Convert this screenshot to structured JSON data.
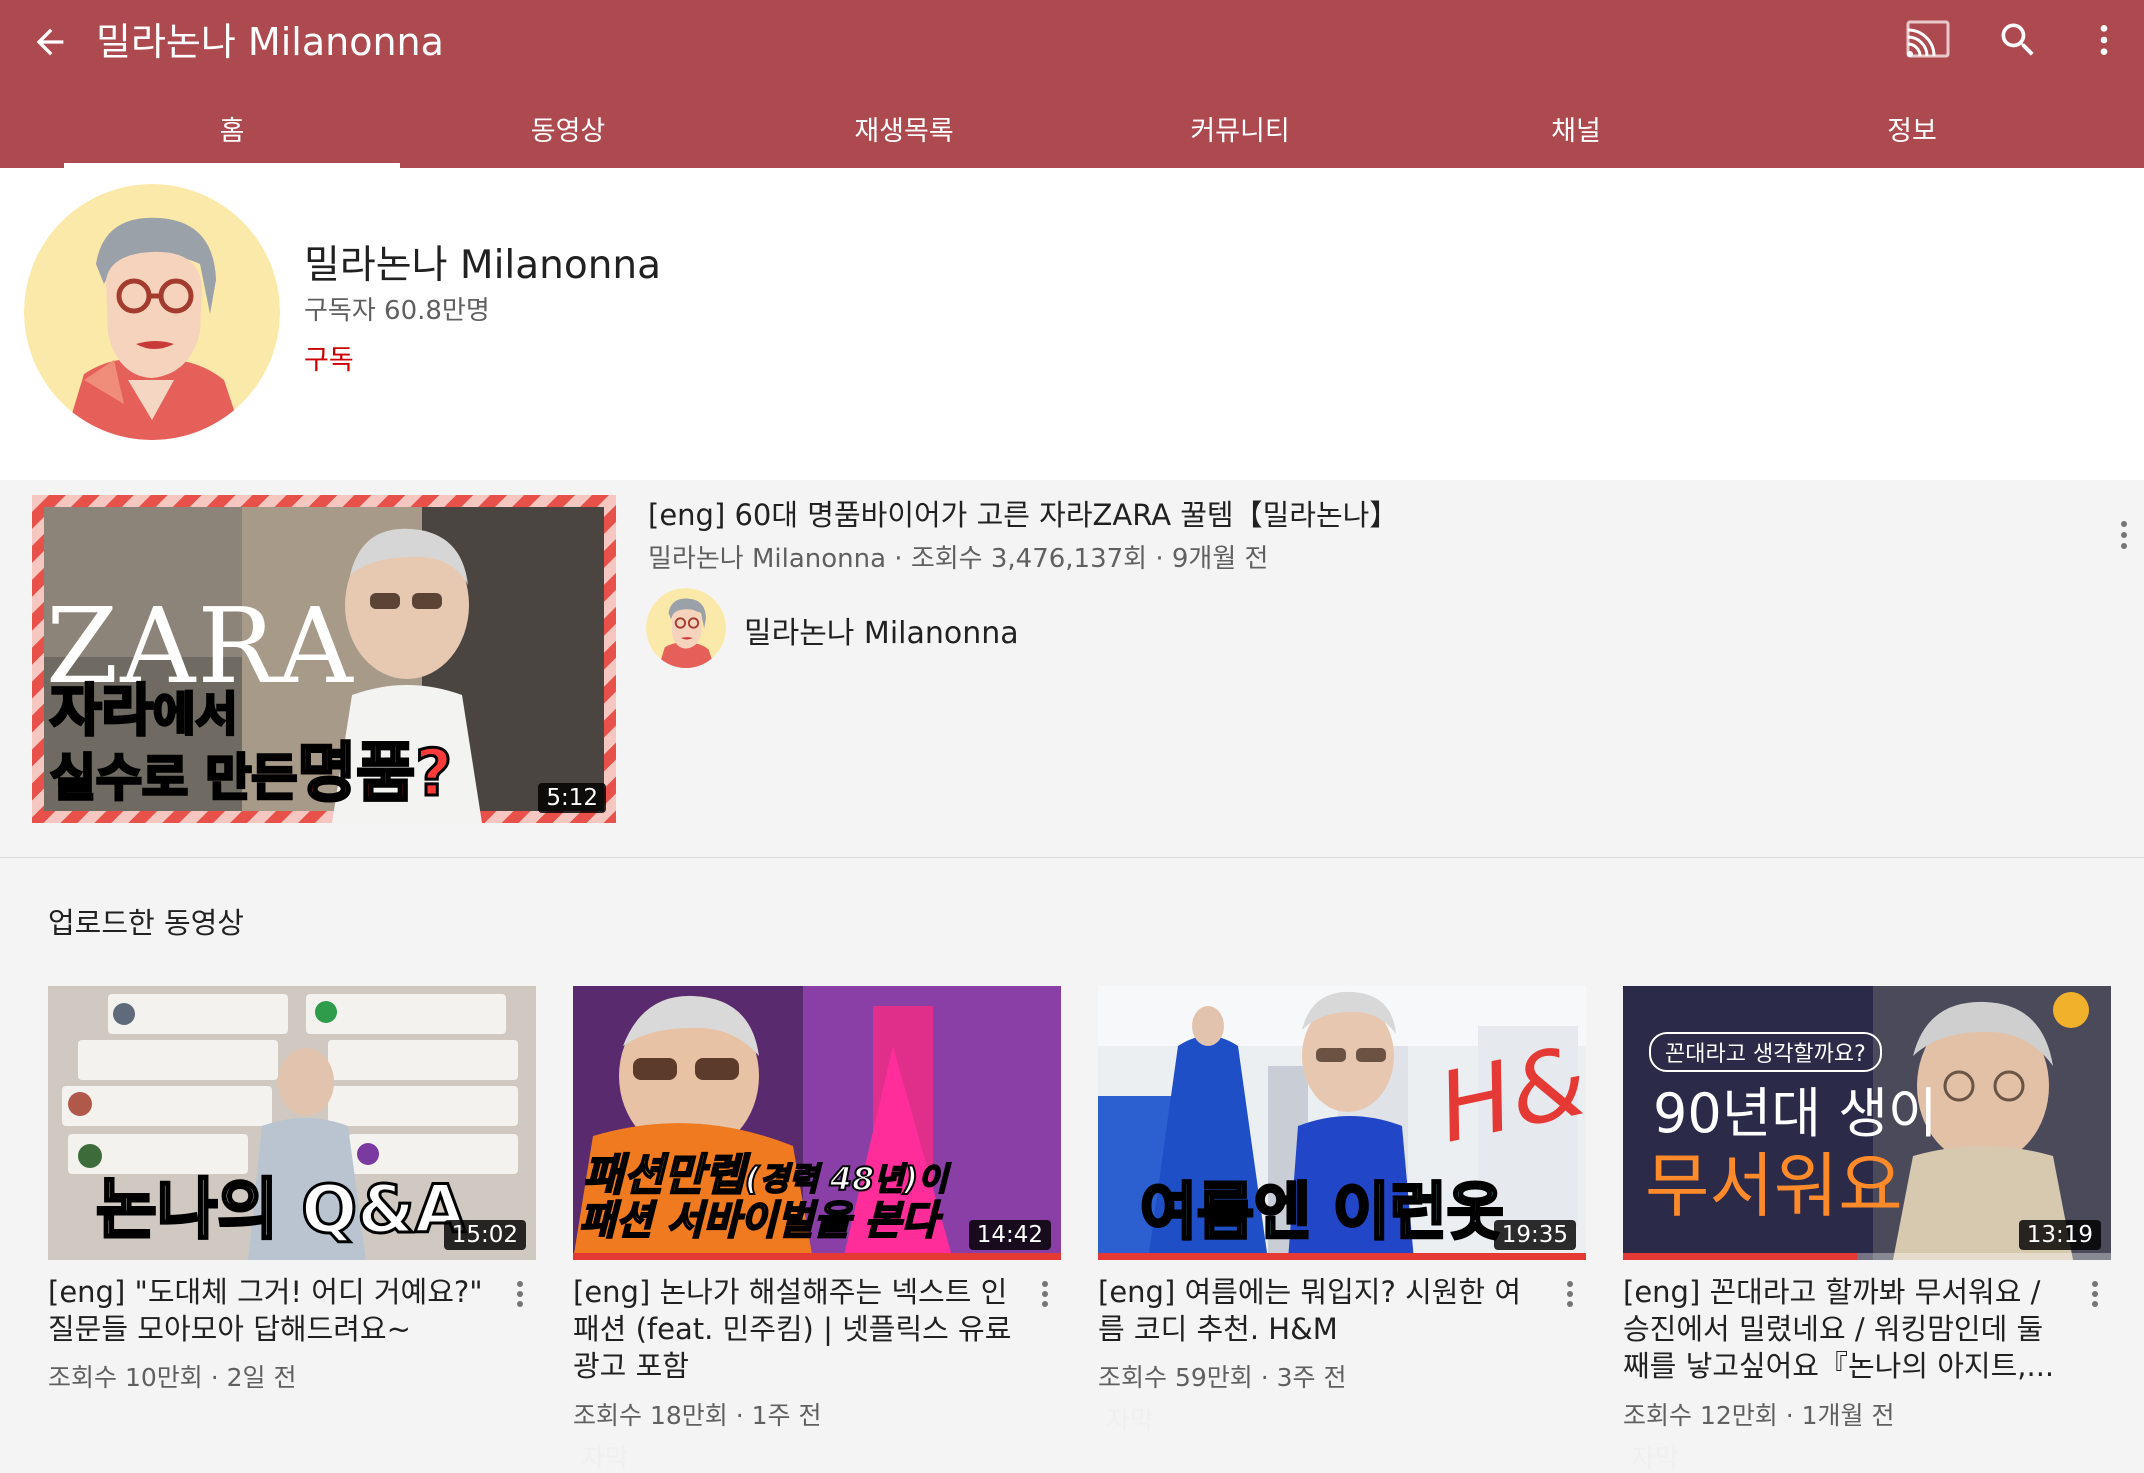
{
  "header": {
    "title": "밀라논나 Milanonna",
    "bg_color": "#ad4a50",
    "icons": {
      "back": "arrow-back-icon",
      "cast": "cast-icon",
      "search": "search-icon",
      "more": "more-vert-icon"
    }
  },
  "tabs": [
    {
      "label": "홈",
      "active": true
    },
    {
      "label": "동영상",
      "active": false
    },
    {
      "label": "재생목록",
      "active": false
    },
    {
      "label": "커뮤니티",
      "active": false
    },
    {
      "label": "채널",
      "active": false
    },
    {
      "label": "정보",
      "active": false
    }
  ],
  "channel": {
    "name": "밀라논나 Milanonna",
    "subscribers": "구독자 60.8만명",
    "subscribe_label": "구독",
    "subscribe_color": "#cc0000"
  },
  "featured": {
    "title": "[eng] 60대 명품바이어가 고른 자라ZARA 꿀템【밀라논나】",
    "meta": "밀라논나 Milanonna · 조회수 3,476,137회 · 9개월 전",
    "channel": "밀라논나 Milanonna",
    "duration": "5:12",
    "thumb_text": {
      "brand": "ZARA",
      "line1a": "자라",
      "line1b": "에서",
      "line2a": "실수로 만든",
      "line2b": "명품?"
    }
  },
  "uploads": {
    "section_title": "업로드한 동영상",
    "videos": [
      {
        "title": "[eng] \"도대체 그거! 어디 거예요?\" 질문들 모아모아 답해드려요~",
        "meta": "조회수 10만회 · 2일 전",
        "duration": "15:02",
        "thumb_text": "논나의 Q&A",
        "caption": "",
        "progress": 0
      },
      {
        "title": "[eng] 논나가 해설해주는 넥스트 인 패션 (feat. 민주킴) | 넷플릭스 유료광고 포함",
        "meta": "조회수 18만회 · 1주 전",
        "duration": "14:42",
        "thumb_text_1": "패션만렙",
        "thumb_text_2": "(경력 48년)이",
        "thumb_text_3": "패션 서바이벌을 본다",
        "caption": "자막",
        "progress": 1.0
      },
      {
        "title": "[eng] 여름에는 뭐입지? 시원한 여름 코디 추천. H&M",
        "meta": "조회수 59만회 · 3주 전",
        "duration": "19:35",
        "thumb_text": "여름엔 이런옷",
        "thumb_brand": "H&M",
        "caption": "자막",
        "progress": 1.0
      },
      {
        "title": "[eng] 꼰대라고 할까봐 무서워요 / 승진에서 밀렸네요 / 워킹맘인데 둘째를 낳고싶어요『논나의 아지트,...",
        "meta": "조회수 12만회 · 1개월 전",
        "duration": "13:19",
        "thumb_text_1": "꼰대라고 생각할까요?",
        "thumb_text_2": "90년대 생이",
        "thumb_text_3": "무서워요",
        "caption": "자막",
        "progress": 0.48
      }
    ]
  }
}
